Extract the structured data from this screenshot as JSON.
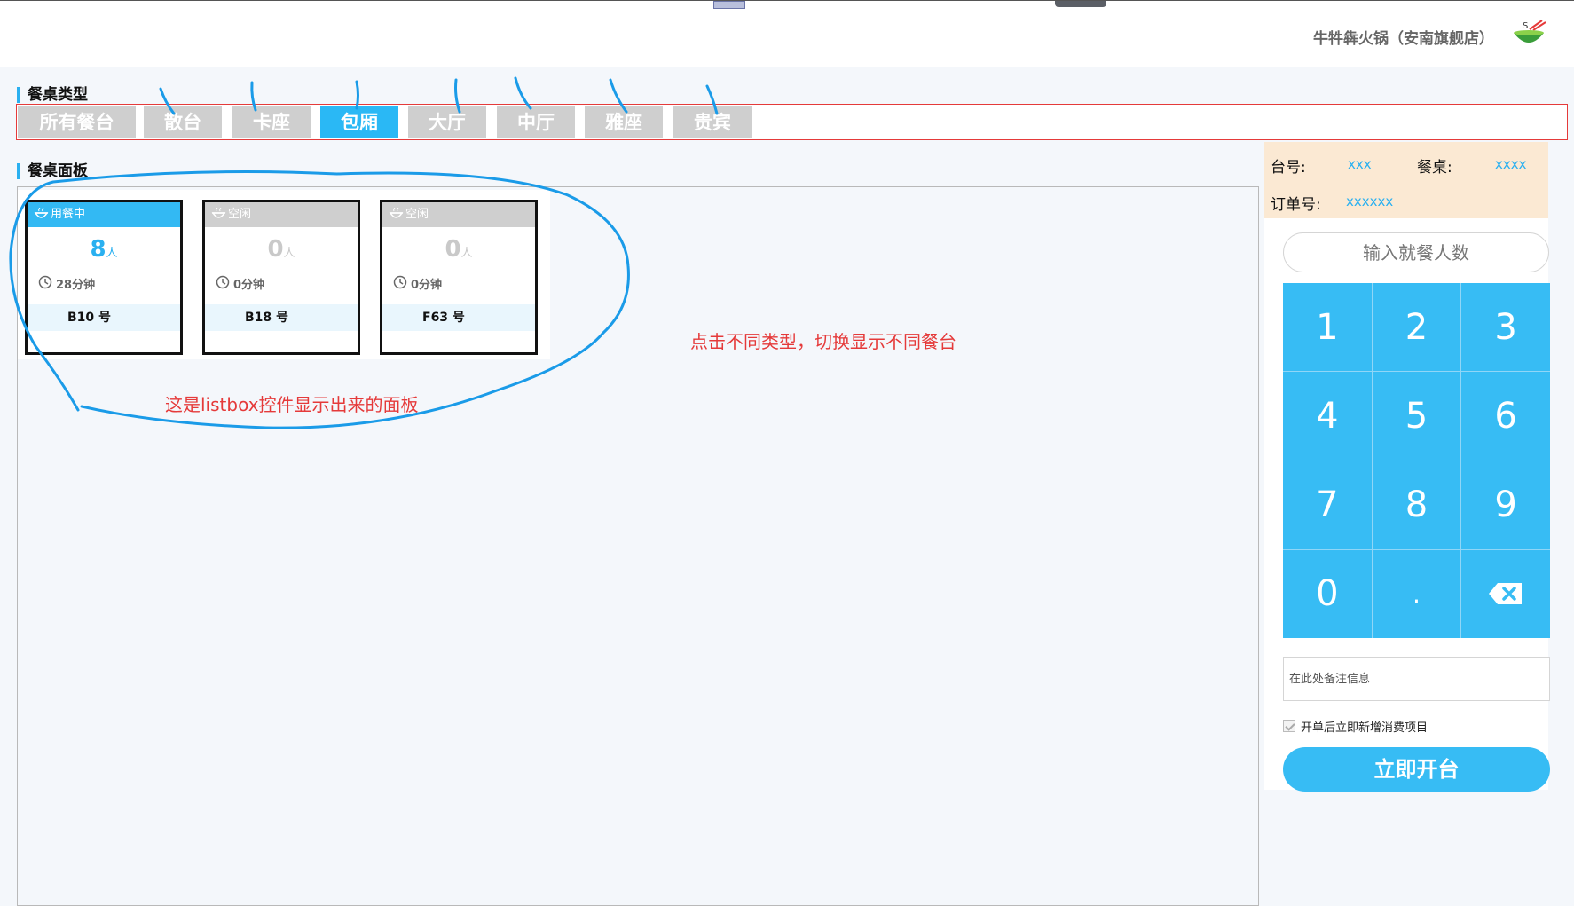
{
  "header": {
    "store_name": "牛牪犇火锅（安南旗舰店）",
    "logo_icon": "hotpot-bowl-icon",
    "logo_text": "S"
  },
  "table_types": {
    "title": "餐桌类型",
    "tabs": [
      {
        "label": "所有餐台",
        "active": false
      },
      {
        "label": "散台",
        "active": false
      },
      {
        "label": "卡座",
        "active": false
      },
      {
        "label": "包厢",
        "active": true
      },
      {
        "label": "大厅",
        "active": false
      },
      {
        "label": "中厅",
        "active": false
      },
      {
        "label": "雅座",
        "active": false
      },
      {
        "label": "贵宾",
        "active": false
      }
    ]
  },
  "board": {
    "title": "餐桌面板",
    "cards": [
      {
        "status": "用餐中",
        "count": "8",
        "unit": "人",
        "duration": "28分钟",
        "table_no": "B10 号",
        "busy": true
      },
      {
        "status": "空闲",
        "count": "0",
        "unit": "人",
        "duration": "0分钟",
        "table_no": "B18 号",
        "busy": false
      },
      {
        "status": "空闲",
        "count": "0",
        "unit": "人",
        "duration": "0分钟",
        "table_no": "F63 号",
        "busy": false
      }
    ]
  },
  "annotations": {
    "switch_hint": "点击不同类型，切换显示不同餐台",
    "listbox_hint": "这是listbox控件显示出来的面板"
  },
  "order_panel": {
    "table_no_label": "台号:",
    "table_no_value": "xxx",
    "table_label": "餐桌:",
    "table_value": "xxxx",
    "order_no_label": "订单号:",
    "order_no_value": "xxxxxx",
    "people_placeholder": "输入就餐人数",
    "keys": [
      "1",
      "2",
      "3",
      "4",
      "5",
      "6",
      "7",
      "8",
      "9",
      "0",
      ".",
      "⌫"
    ],
    "remark_placeholder": "在此处备注信息",
    "checkbox_label": "开单后立即新增消费项目",
    "open_button": "立即开台"
  },
  "colors": {
    "accent": "#37bcf4",
    "annotation_red": "#e53a3a",
    "info_background": "#fbe9d3",
    "tab_inactive": "#cfcfcf"
  }
}
